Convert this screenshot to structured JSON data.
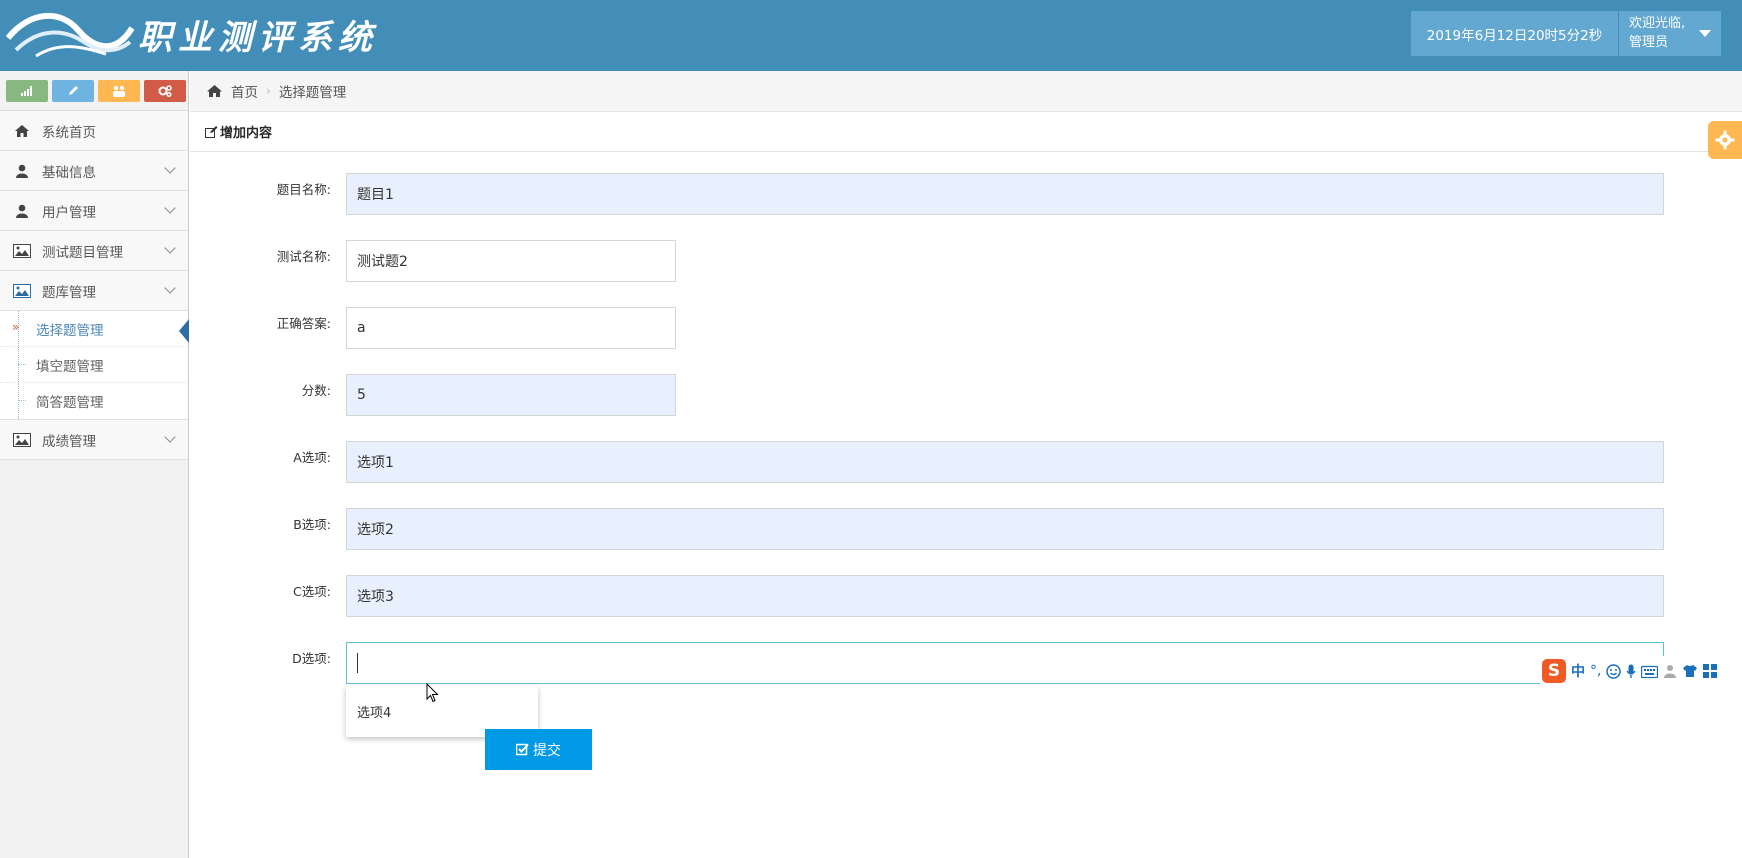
{
  "header": {
    "app_title": "职业测评系统",
    "datetime": "2019年6月12日20时5分2秒",
    "welcome": "欢迎光临,",
    "username": "管理员"
  },
  "shortcuts": [
    {
      "icon": "signal-icon",
      "color": "#87b87f"
    },
    {
      "icon": "pencil-icon",
      "color": "#6fb3e0"
    },
    {
      "icon": "users-icon",
      "color": "#ffb752"
    },
    {
      "icon": "cogs-icon",
      "color": "#d15b47"
    }
  ],
  "sidebar": {
    "items": [
      {
        "label": "系统首页",
        "icon": "home-icon"
      },
      {
        "label": "基础信息",
        "icon": "user-icon"
      },
      {
        "label": "用户管理",
        "icon": "user-icon"
      },
      {
        "label": "测试题目管理",
        "icon": "picture-icon"
      },
      {
        "label": "题库管理",
        "icon": "picture-icon"
      },
      {
        "label": "成绩管理",
        "icon": "picture-icon"
      }
    ],
    "submenu": [
      {
        "label": "选择题管理",
        "active": true
      },
      {
        "label": "填空题管理",
        "active": false
      },
      {
        "label": "简答题管理",
        "active": false
      }
    ]
  },
  "breadcrumb": {
    "home": "首页",
    "current": "选择题管理"
  },
  "content": {
    "title": "增加内容"
  },
  "form": {
    "fields": [
      {
        "label": "题目名称:",
        "value": "题目1"
      },
      {
        "label": "测试名称:",
        "value": "测试题2"
      },
      {
        "label": "正确答案:",
        "value": "a"
      },
      {
        "label": "分数:",
        "value": "5"
      },
      {
        "label": "A选项:",
        "value": "选项1"
      },
      {
        "label": "B选项:",
        "value": "选项2"
      },
      {
        "label": "C选项:",
        "value": "选项3"
      },
      {
        "label": "D选项:",
        "value": ""
      }
    ],
    "autocomplete": "选项4",
    "submit": "提交"
  },
  "ime": {
    "mode": "中",
    "punct": "°,"
  }
}
